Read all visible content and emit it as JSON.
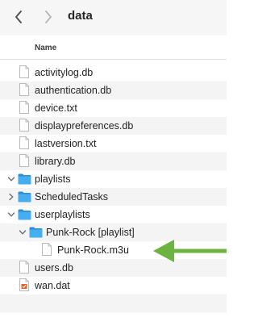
{
  "toolbar": {
    "title": "data",
    "back_icon": "chevron-left-icon",
    "forward_icon": "chevron-right-icon"
  },
  "header": {
    "name_column": "Name"
  },
  "files": [
    {
      "name": "activitylog.db",
      "kind": "file",
      "depth": 0
    },
    {
      "name": "authentication.db",
      "kind": "file",
      "depth": 0
    },
    {
      "name": "device.txt",
      "kind": "file",
      "depth": 0
    },
    {
      "name": "displaypreferences.db",
      "kind": "file",
      "depth": 0
    },
    {
      "name": "lastversion.txt",
      "kind": "file",
      "depth": 0
    },
    {
      "name": "library.db",
      "kind": "file",
      "depth": 0
    },
    {
      "name": "playlists",
      "kind": "folder",
      "depth": 0,
      "expanded": true
    },
    {
      "name": "ScheduledTasks",
      "kind": "folder",
      "depth": 0,
      "expanded": false
    },
    {
      "name": "userplaylists",
      "kind": "folder",
      "depth": 0,
      "expanded": true
    },
    {
      "name": "Punk-Rock [playlist]",
      "kind": "folder",
      "depth": 1,
      "expanded": true
    },
    {
      "name": "Punk-Rock.m3u",
      "kind": "file",
      "depth": 2
    },
    {
      "name": "users.db",
      "kind": "file",
      "depth": 0
    },
    {
      "name": "wan.dat",
      "kind": "script-file",
      "depth": 0
    }
  ],
  "annotation": {
    "arrow_color": "#6cb33f",
    "icon": "green-arrow-icon"
  },
  "colors": {
    "folder": "#45aef0",
    "stripe": "#f4f4f5"
  }
}
